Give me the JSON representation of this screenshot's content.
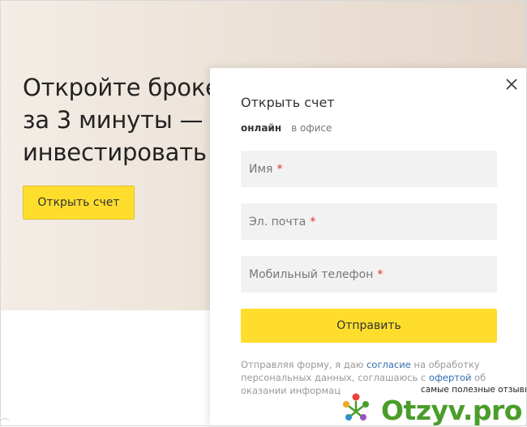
{
  "hero": {
    "title": "Откройте броке\nза 3 минуты — и\nинвестировать",
    "button_label": "Открыть счет"
  },
  "modal": {
    "title": "Открыть счет",
    "tabs": [
      {
        "label": "онлайн",
        "active": true
      },
      {
        "label": "в офисе",
        "active": false
      }
    ],
    "fields": [
      {
        "placeholder": "Имя",
        "required": "*"
      },
      {
        "placeholder": "Эл. почта",
        "required": "*"
      },
      {
        "placeholder": "Мобильный телефон",
        "required": "*"
      }
    ],
    "submit_label": "Отправить",
    "disclaimer": {
      "text1": "Отправляя форму, я даю ",
      "link1": "согласие",
      "text2": " на обработку персональных данных, соглашаюсь с ",
      "link2": "офертой",
      "text3": " об оказании информац"
    }
  },
  "watermark": {
    "tagline": "самые полезные отзывы",
    "logo": "Otzyv.pro"
  },
  "colors": {
    "accent_yellow": "#ffdd2d",
    "required_red": "#e22e2e",
    "link_blue": "#336fae",
    "logo_green": "#4a9d2a"
  }
}
